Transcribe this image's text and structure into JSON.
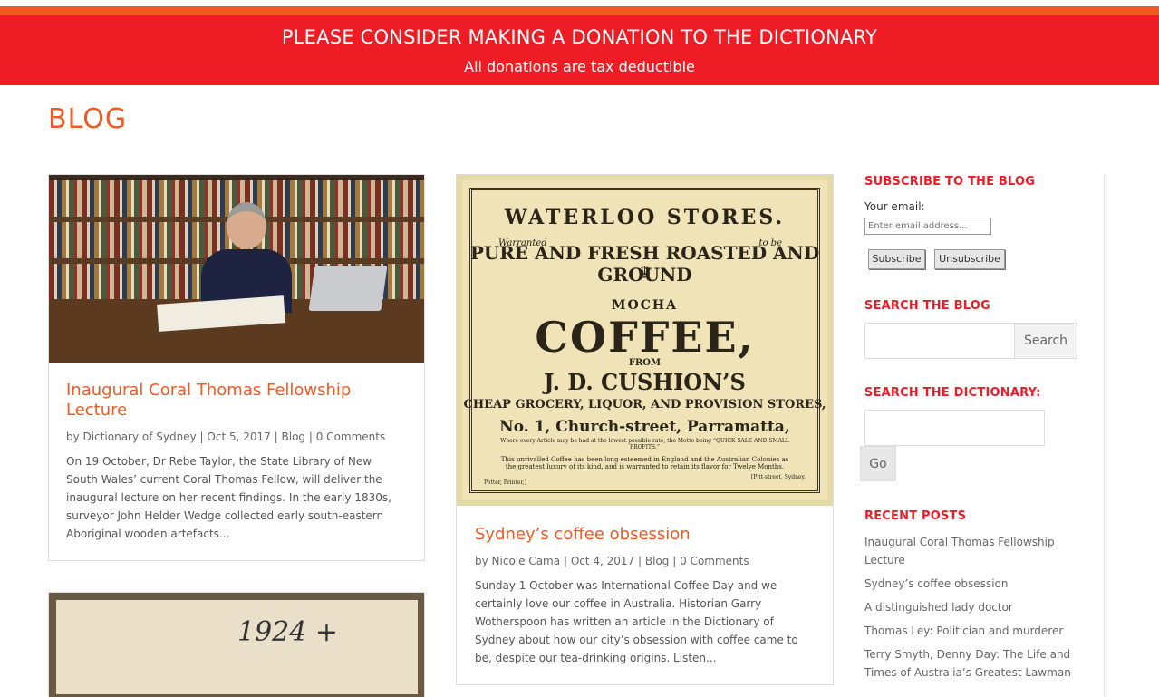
{
  "banner": {
    "title": "PLEASE CONSIDER MAKING A DONATION TO THE DICTIONARY",
    "subtitle": "All donations are tax deductible",
    "color": "#ee1c25",
    "accent": "#f05a22"
  },
  "page_title": "BLOG",
  "posts": [
    {
      "title": "Inaugural Coral Thomas Fellowship Lecture",
      "author": "Dictionary of Sydney",
      "date": "Oct 5, 2017",
      "category": "Blog",
      "comments": "0 Comments",
      "excerpt": "On 19 October, Dr Rebe Taylor, the State Library of New South Wales’ current Coral Thomas Fellow, will deliver the inaugural lecture on her recent findings. In the early 1830s, surveyor John Helder Wedge collected early south-eastern Aboriginal wooden artefacts..."
    },
    {
      "title": "Sydney’s coffee obsession",
      "author": "Nicole Cama",
      "date": "Oct 4, 2017",
      "category": "Blog",
      "comments": "0 Comments",
      "excerpt": "Sunday 1 October was International Coffee Day and we certainly love our coffee in Australia. Historian Garry Wotherspoon has written an article in the Dictionary of Sydney about how our city’s obsession with coffee came to be, despite our tea-drinking origins. Listen...",
      "poster": {
        "header": "WATERLOO STORES.",
        "warranted": "Warranted",
        "to_be": "to be",
        "arc": "PURE AND FRESH ROASTED AND GROUND",
        "mocha": "MOCHA",
        "coffee": "COFFEE,",
        "from": "FROM",
        "cushion": "J. D. CUSHION’S",
        "stores": "CHEAP GROCERY, LIQUOR, AND PROVISION STORES,",
        "address": "No. 1, Church-street, Parramatta,",
        "motto": "Where every Article may be had at the lowest possible rate, the Motto being “QUICK SALE AND SMALL PROFITS.”",
        "blurb": "This unrivalled Coffee has been long esteemed in England and the Australian Colonies as the greatest luxury of its kind, and is warranted to retain its flavor for Twelve Months.",
        "printer": "Potter, Printer,]",
        "street": "[Pitt-street, Sydney."
      }
    },
    {
      "photo_text": "1924 +"
    }
  ],
  "meta": {
    "by": "by",
    "sep": "|"
  },
  "sidebar": {
    "subscribe_heading": "SUBSCRIBE TO THE BLOG",
    "email_label": "Your email:",
    "email_placeholder": "Enter email address...",
    "subscribe_label": "Subscribe",
    "unsubscribe_label": "Unsubscribe",
    "search_heading": "SEARCH THE BLOG",
    "search_label": "Search",
    "dictionary_heading": "SEARCH THE DICTIONARY:",
    "go_label": "Go",
    "recent_heading": "RECENT POSTS",
    "recent_posts": [
      "Inaugural Coral Thomas Fellowship Lecture",
      "Sydney’s coffee obsession",
      "A distinguished lady doctor",
      "Thomas Ley: Politician and murderer",
      "Terry Smyth, Denny Day: The Life and Times of Australia’s Greatest Lawman"
    ]
  }
}
